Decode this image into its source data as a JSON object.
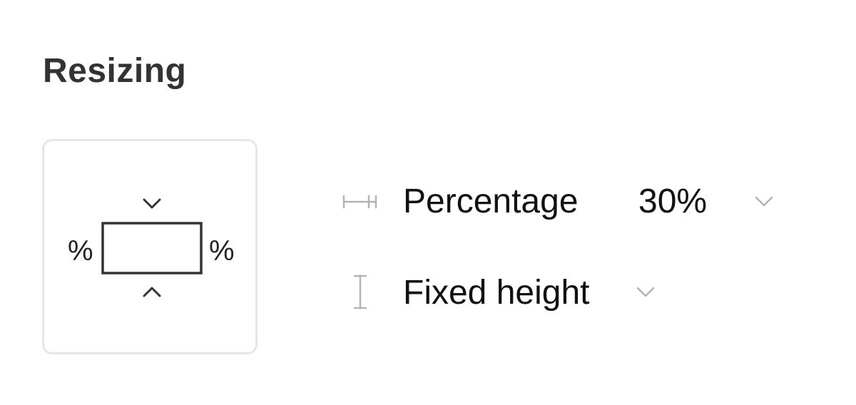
{
  "section": {
    "title": "Resizing"
  },
  "constraints": {
    "left_label": "%",
    "right_label": "%",
    "top_icon": "chevron-down-icon",
    "bottom_icon": "chevron-up-icon"
  },
  "width_row": {
    "icon": "horizontal-resize-icon",
    "mode": "Percentage",
    "value": "30%",
    "dropdown_icon": "chevron-down-icon"
  },
  "height_row": {
    "icon": "vertical-resize-icon",
    "mode": "Fixed height",
    "dropdown_icon": "chevron-down-icon"
  },
  "colors": {
    "text": "#111111",
    "title": "#333333",
    "icon_muted": "#b3b3b3",
    "box_border": "#e6e6e6",
    "frame_stroke": "#333333"
  }
}
